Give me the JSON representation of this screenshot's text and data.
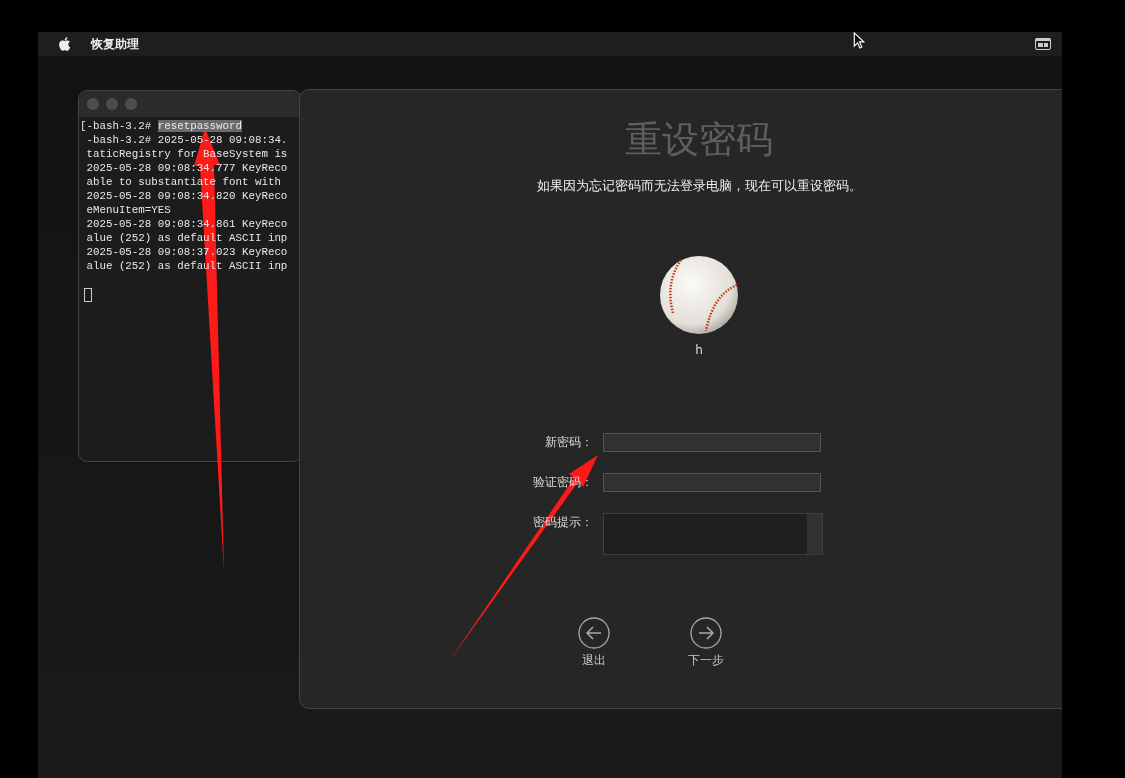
{
  "menu_bar": {
    "app_name": "恢复助理"
  },
  "terminal": {
    "lines": [
      {
        "text": "[-bash-3.2# ",
        "selected_text": "resetpassword"
      },
      {
        "text": " -bash-3.2# 2025-05-28 09:08:34."
      },
      {
        "text": " taticRegistry for BaseSystem is"
      },
      {
        "text": " 2025-05-28 09:08:34.777 KeyReco"
      },
      {
        "text": " able to substantiate font with"
      },
      {
        "text": " 2025-05-28 09:08:34.820 KeyReco"
      },
      {
        "text": " eMenuItem=YES"
      },
      {
        "text": " 2025-05-28 09:08:34.861 KeyReco"
      },
      {
        "text": " alue (252) as default ASCII inp"
      },
      {
        "text": " 2025-05-28 09:08:37.023 KeyReco"
      },
      {
        "text": " alue (252) as default ASCII inp"
      }
    ]
  },
  "dialog": {
    "title": "重设密码",
    "subtitle": "如果因为忘记密码而无法登录电脑，现在可以重设密码。",
    "user": {
      "name": "h"
    },
    "fields": [
      {
        "label": "新密码：",
        "kind": "text"
      },
      {
        "label": "验证密码：",
        "kind": "text"
      },
      {
        "label": "密码提示：",
        "kind": "textarea"
      }
    ],
    "buttons": [
      {
        "label": "退出",
        "kind": "back"
      },
      {
        "label": "下一步",
        "kind": "next"
      }
    ]
  }
}
